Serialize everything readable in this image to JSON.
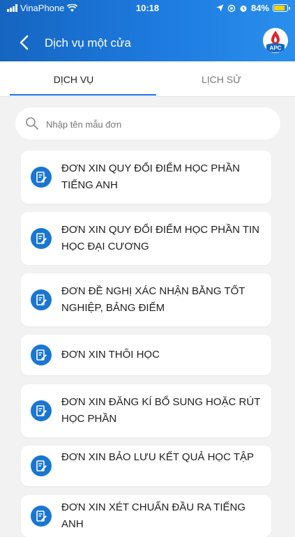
{
  "status_bar": {
    "carrier": "VinaPhone",
    "time": "10:18",
    "battery": "84%",
    "battery_level": 0.84
  },
  "navbar": {
    "title": "Dịch vụ một cửa",
    "logo_text": "APC"
  },
  "tabs": [
    {
      "label": "DỊCH VỤ",
      "active": true
    },
    {
      "label": "LỊCH SỬ",
      "active": false
    }
  ],
  "search": {
    "placeholder": "Nhập tên mẫu đơn",
    "value": ""
  },
  "forms": [
    {
      "label": "ĐƠN XIN QUY ĐỔI ĐIỂM HỌC PHẦN TIẾNG ANH",
      "icon": "edit-document-icon"
    },
    {
      "label": "ĐƠN XIN QUY ĐỔI ĐIỂM HỌC PHẦN TIN HỌC ĐẠI CƯƠNG",
      "icon": "edit-document-icon"
    },
    {
      "label": "ĐƠN ĐỀ NGHỊ XÁC NHẬN BẰNG TỐT NGHIỆP, BẢNG ĐIỂM",
      "icon": "edit-document-icon"
    },
    {
      "label": "ĐƠN XIN THÔI HỌC",
      "icon": "edit-document-icon"
    },
    {
      "label": "ĐƠN XIN ĐĂNG KÍ BỔ SUNG HOẶC RÚT HỌC PHẦN",
      "icon": "edit-document-icon"
    },
    {
      "label": "ĐƠN XIN BẢO LƯU KẾT QUẢ HỌC TẬP",
      "icon": "edit-document-icon"
    },
    {
      "label": "ĐƠN XIN XÉT CHUẨN ĐẦU RA TIẾNG ANH",
      "icon": "edit-document-icon"
    }
  ],
  "colors": {
    "header_blue": "#1e7be0",
    "accent": "#1a73e8",
    "icon_blue": "#1976d2",
    "background": "#f2f2f2"
  }
}
